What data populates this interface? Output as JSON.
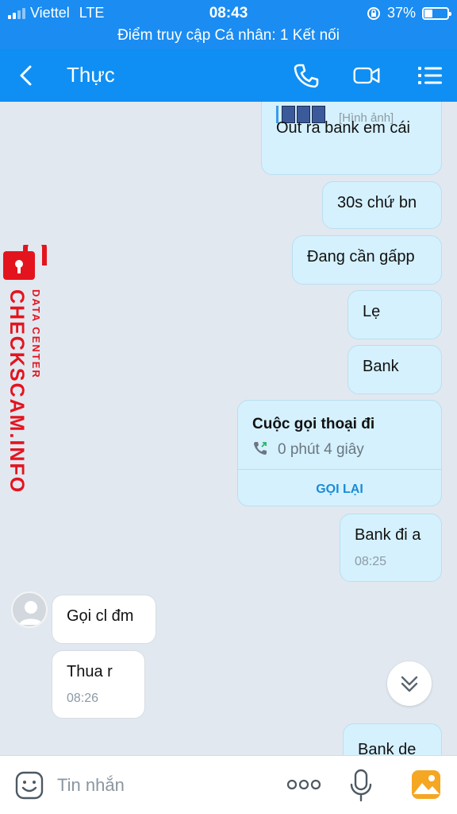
{
  "status_bar": {
    "carrier": "Viettel",
    "network": "LTE",
    "time": "08:43",
    "battery": "37%",
    "battery_level": 0.37
  },
  "hotspot_banner": "Điểm truy cập Cá nhân: 1 Kết nối",
  "header": {
    "title": "Thực"
  },
  "image_message": {
    "caption": "[Hình ảnh]",
    "text": "Out ra bank em cái"
  },
  "outgoing_messages": [
    "30s chứ bn",
    "Đang cần gấpp",
    "Lẹ",
    "Bank"
  ],
  "call_card": {
    "title": "Cuộc gọi thoại đi",
    "duration": "0 phút 4 giây",
    "action": "GỌI LẠI"
  },
  "bank_message": {
    "text": "Bank đi a",
    "time": "08:25"
  },
  "incoming_messages": [
    {
      "text": "Gọi cl đm"
    },
    {
      "text": "Thua r",
      "time": "08:26"
    }
  ],
  "last_message": {
    "text": "Bank de"
  },
  "watermark": {
    "brand": "CHECKSCAM.INFO",
    "subtitle": "DATA CENTER"
  },
  "input_bar": {
    "placeholder": "Tin nhắn"
  },
  "colors": {
    "accent": "#0f8ff3",
    "out_bubble": "#d5f1fd",
    "watermark": "#e3141e",
    "call_green": "#2cb566"
  }
}
